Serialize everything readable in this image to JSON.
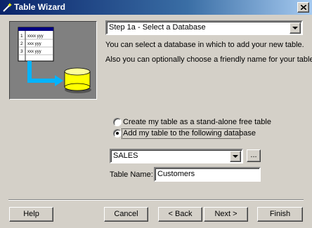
{
  "window": {
    "title": "Table Wizard",
    "close_label": "×"
  },
  "illustration": {
    "rows": [
      {
        "num": "1",
        "text": "xxxx yyy"
      },
      {
        "num": "2",
        "text": "xxx yyy"
      },
      {
        "num": "3",
        "text": "xxx yyy"
      }
    ],
    "colors": {
      "arrow": "#00b4ff",
      "database": "#ffff00",
      "panel": "#808080"
    }
  },
  "step": {
    "selected": "Step 1a - Select a Database"
  },
  "description": {
    "line1": "You can select a database in which to add your new table.",
    "line2": "Also you can optionally choose a friendly name for your table."
  },
  "options": {
    "radio_free_table": {
      "label": "Create my table as a stand-alone free table",
      "checked": false
    },
    "radio_add_to_db": {
      "label": "Add my table to the following database",
      "checked": true
    }
  },
  "database": {
    "selected": "SALES",
    "browse_label": "..."
  },
  "table_name": {
    "label": "Table Name:",
    "value": "Customers"
  },
  "buttons": {
    "help": "Help",
    "cancel": "Cancel",
    "back": "< Back",
    "next": "Next >",
    "finish": "Finish"
  }
}
